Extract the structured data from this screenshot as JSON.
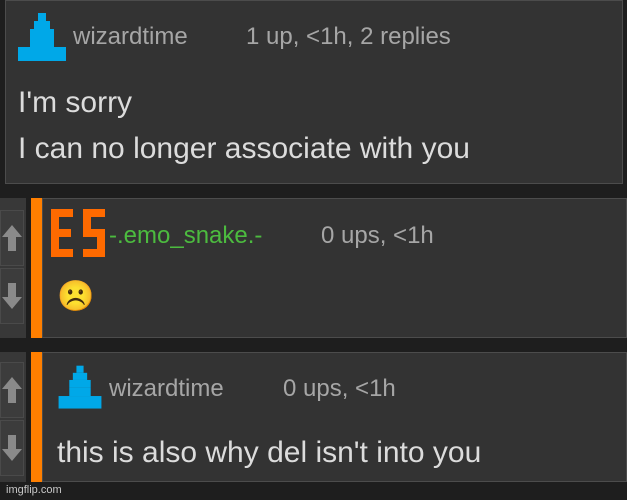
{
  "comments": [
    {
      "username": "wizardtime",
      "meta": "1 up, <1h, 2 replies",
      "lines": [
        "I'm sorry",
        "I can no longer associate with you"
      ]
    },
    {
      "username": "-.emo_snake.-",
      "username_color": "#4cbb3f",
      "meta": "0 ups, <1h",
      "lines": [
        "☹️"
      ]
    },
    {
      "username": "wizardtime",
      "meta": "0 ups, <1h",
      "lines": [
        "this is also why del isn't into you"
      ]
    }
  ],
  "colors": {
    "reply_bar": "#ff7f00",
    "avatar_blue": "#00a8e8",
    "avatar_orange": "#ff6a00",
    "card_bg": "#333333"
  },
  "watermark": "imgflip.com"
}
